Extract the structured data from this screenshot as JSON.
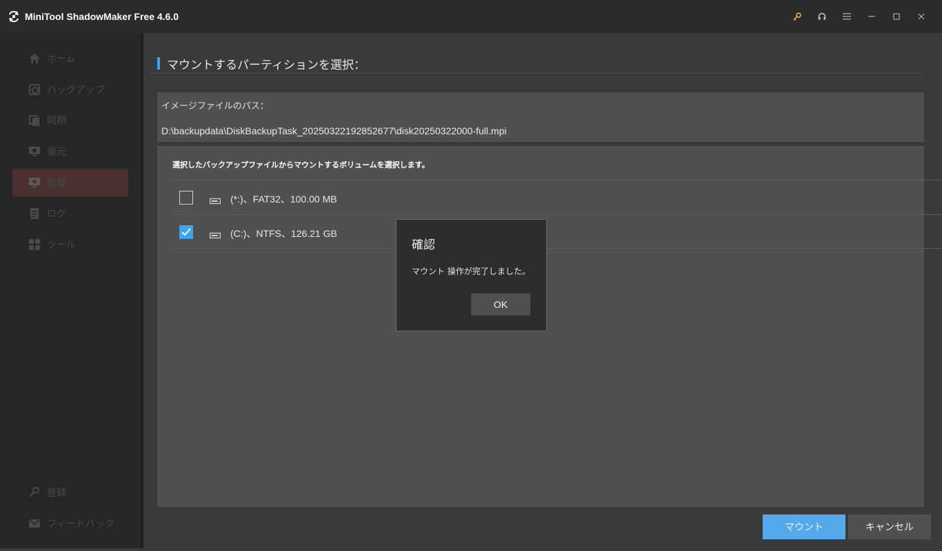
{
  "app": {
    "title": "MiniTool ShadowMaker Free 4.6.0"
  },
  "title_bar": {
    "icons": [
      "key-icon",
      "headset-icon",
      "menu-icon",
      "minimize-icon",
      "maximize-icon",
      "close-icon"
    ]
  },
  "sidebar": {
    "items": [
      {
        "label": "ホーム",
        "icon": "home-icon"
      },
      {
        "label": "バックアップ",
        "icon": "backup-icon"
      },
      {
        "label": "同期",
        "icon": "sync-icon"
      },
      {
        "label": "復元",
        "icon": "restore-icon"
      },
      {
        "label": "管理",
        "icon": "manage-icon",
        "active": true
      },
      {
        "label": "ログ",
        "icon": "log-icon"
      },
      {
        "label": "ツール",
        "icon": "tools-icon"
      }
    ],
    "bottom_items": [
      {
        "label": "登録",
        "icon": "key-icon"
      },
      {
        "label": "フィードバック",
        "icon": "mail-icon"
      }
    ]
  },
  "main": {
    "section_title": "マウントするパーティションを選択：",
    "image_path_label": "イメージファイルのパス：",
    "image_path_value": "D:\\backupdata\\DiskBackupTask_20250322192852677\\disk20250322000-full.mpi",
    "instruction": "選択したバックアップファイルからマウントするボリュームを選択します。",
    "volumes": [
      {
        "label": "(*:)、FAT32、100.00 MB",
        "checked": false
      },
      {
        "label": "(C:)、NTFS、126.21 GB",
        "checked": true
      }
    ],
    "mount_button": "マウント",
    "cancel_button": "キャンセル"
  },
  "dialog": {
    "title": "確認",
    "message": "マウント 操作が完了しました。",
    "ok_button": "OK"
  },
  "colors": {
    "accent": "#3fa3f0",
    "sidebar_active": "#4a2f2f",
    "key_icon": "#e8b24a"
  }
}
